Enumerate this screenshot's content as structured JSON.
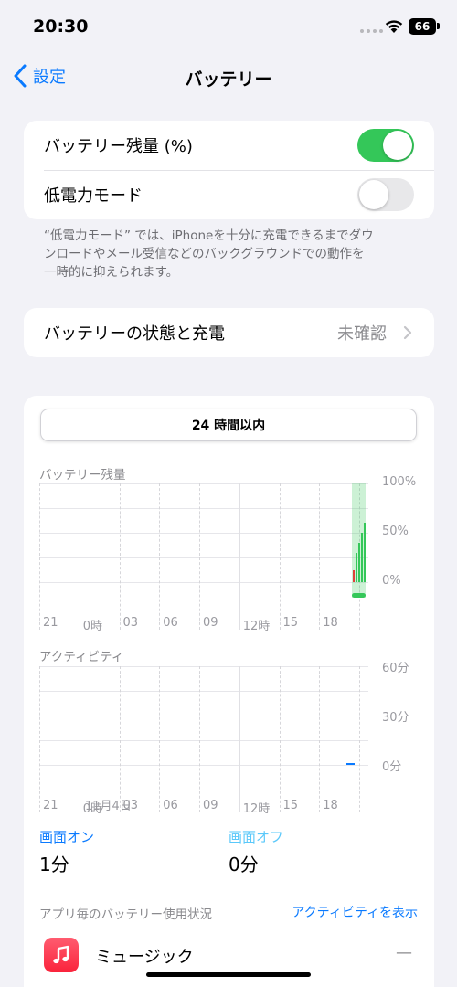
{
  "status_bar": {
    "time": "20:30",
    "battery_level": "66"
  },
  "nav": {
    "back_label": "設定",
    "title": "バッテリー"
  },
  "settings": {
    "battery_percentage_label": "バッテリー残量 (%)",
    "battery_percentage_on": true,
    "low_power_label": "低電力モード",
    "low_power_on": false,
    "footnote_lines": [
      "“低電力モード” では、iPhoneを十分に充電できるまでダウ",
      "ンロードやメール受信などのバックグラウンドでの動作を",
      "一時的に抑えられます。"
    ]
  },
  "battery_health": {
    "label": "バッテリーの状態と充電",
    "value": "未確認"
  },
  "usage": {
    "period_button": "24 時間以内",
    "battery_section_label": "バッテリー残量",
    "activity_section_label": "アクティビティ",
    "date_label": "11月4日",
    "screen_on_label": "画面オン",
    "screen_on_value": "1分",
    "screen_off_label": "画面オフ",
    "screen_off_value": "0分",
    "apps_label": "アプリ毎のバッテリー使用状況",
    "show_activity_link": "アクティビティを表示"
  },
  "chart_data": [
    {
      "type": "bar",
      "title": "バッテリー残量",
      "x_tick_labels": [
        "21",
        "0時",
        "03",
        "06",
        "09",
        "12時",
        "15",
        "18"
      ],
      "y_tick_labels": [
        "100%",
        "50%",
        "0%"
      ],
      "ylim": [
        0,
        100
      ],
      "charging_highlight": true,
      "bars": [
        {
          "value": 12,
          "color": "#e0413a"
        },
        {
          "value": 30,
          "color": "#34c759"
        },
        {
          "value": 40,
          "color": "#34c759"
        },
        {
          "value": 50,
          "color": "#34c759"
        },
        {
          "value": 60,
          "color": "#34c759"
        }
      ]
    },
    {
      "type": "bar",
      "title": "アクティビティ",
      "x_tick_labels": [
        "21",
        "0時",
        "03",
        "06",
        "09",
        "12時",
        "15",
        "18"
      ],
      "y_tick_labels": [
        "60分",
        "30分",
        "0分"
      ],
      "ylim": [
        0,
        60
      ],
      "bars": [
        {
          "value": 1,
          "color": "#0a7aff"
        }
      ]
    }
  ],
  "apps": [
    {
      "name": "ミュージック",
      "usage": "—"
    }
  ],
  "colors": {
    "accent": "#0a7aff",
    "toggle_on": "#34c759",
    "charging": "#34c759",
    "screen_off": "#5ac8fa"
  }
}
